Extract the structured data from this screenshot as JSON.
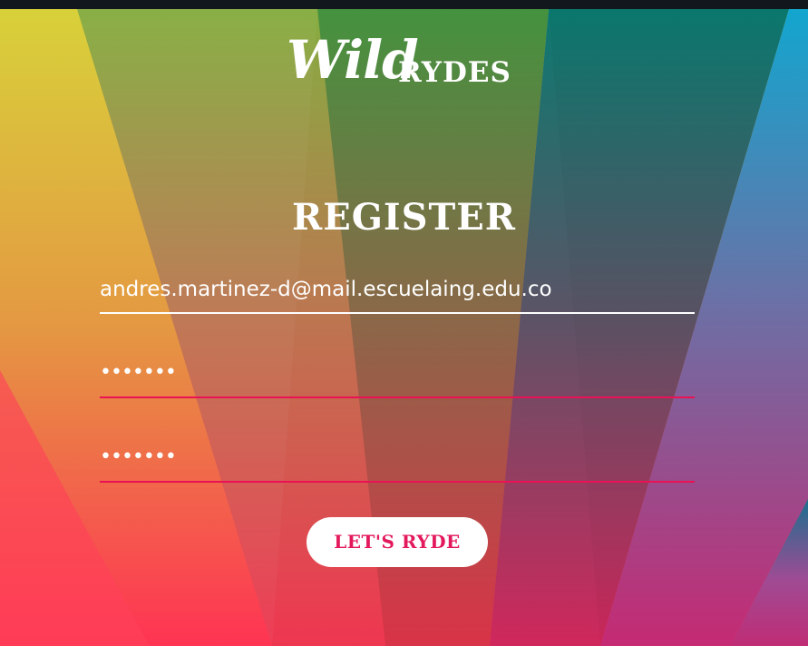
{
  "brand": {
    "logo_script": "Wild",
    "logo_caps": "RYDES"
  },
  "form": {
    "title": "REGISTER",
    "email_value": "andres.martinez-d@mail.escuelaing.edu.co",
    "password_value": "•••••••",
    "confirm_password_value": "•••••••",
    "submit_label": "LET'S RYDE"
  },
  "colors": {
    "accent": "#e3195b",
    "invalid_underline": "#ea1254",
    "text": "#ffffff"
  }
}
